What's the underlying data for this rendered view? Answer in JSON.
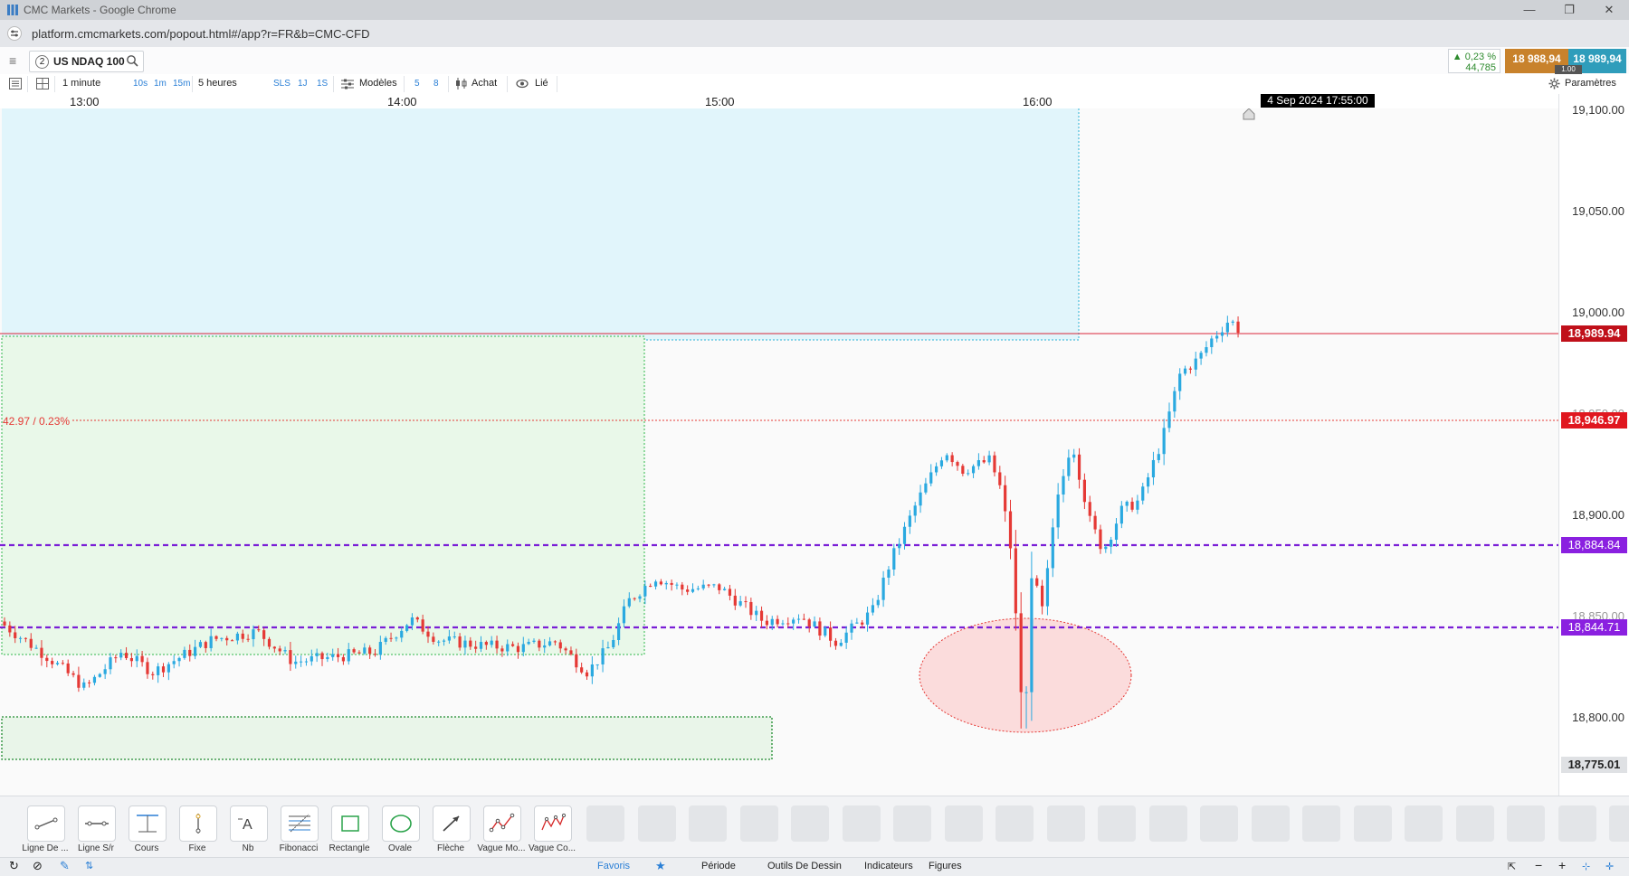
{
  "browser": {
    "window_title": "CMC Markets - Google Chrome",
    "url": "platform.cmcmarkets.com/popout.html#/app?r=FR&b=CMC-CFD"
  },
  "instrument": {
    "slot": "2",
    "name": "US NDAQ 100",
    "change_pct": "▲ 0,23 %",
    "change_pts": "44,785",
    "sell_price": "18 988,94",
    "buy_price": "18 989,94",
    "spread": "1.00"
  },
  "toolbar": {
    "interval": "1 minute",
    "quick_intervals": [
      "10s",
      "1m",
      "15m"
    ],
    "range": "5 heures",
    "range_quick": [
      "SLS",
      "1J",
      "1S"
    ],
    "templates": "Modèles",
    "num_a": "5",
    "num_b": "8",
    "order": "Achat",
    "link": "Lié",
    "settings": "Paramètres"
  },
  "time_axis": {
    "labels": [
      "13:00",
      "14:00",
      "15:00",
      "16:00"
    ],
    "cursor": "4 Sep 2024 17:55:00"
  },
  "price_axis": {
    "labels": [
      "19,100.00",
      "19,050.00",
      "19,000.00",
      "18,950.00",
      "18,900.00",
      "18,850.00",
      "18,800.00"
    ],
    "current_price": "18,989.94",
    "ref_price": "18,946.97",
    "level_upper": "18,884.84",
    "level_lower": "18,844.71",
    "low_price": "18,775.01"
  },
  "chart_annotations": {
    "ref_label": "42.97 / 0.23%"
  },
  "colors": {
    "up": "#2aa9e0",
    "down": "#e53935",
    "current": "#c0101a",
    "level": "#8a2be2",
    "zone_blue": "#e1f5fb",
    "zone_green": "#e9f8e9"
  },
  "drawing_tools": [
    {
      "label": "Ligne De ...",
      "icon": "line-icon"
    },
    {
      "label": "Ligne S/r",
      "icon": "sr-line-icon"
    },
    {
      "label": "Cours",
      "icon": "price-line-icon"
    },
    {
      "label": "Fixe",
      "icon": "fixed-line-icon"
    },
    {
      "label": "Nb",
      "icon": "text-icon"
    },
    {
      "label": "Fibonacci",
      "icon": "fibonacci-icon"
    },
    {
      "label": "Rectangle",
      "icon": "rectangle-icon"
    },
    {
      "label": "Ovale",
      "icon": "oval-icon"
    },
    {
      "label": "Flèche",
      "icon": "arrow-icon"
    },
    {
      "label": "Vague Mo...",
      "icon": "wave-icon"
    },
    {
      "label": "Vague Co...",
      "icon": "wave-corrective-icon"
    }
  ],
  "bottom_tabs": {
    "favorites": "Favoris",
    "period": "Période",
    "drawing": "Outils De Dessin",
    "indicators": "Indicateurs",
    "figures": "Figures"
  }
}
